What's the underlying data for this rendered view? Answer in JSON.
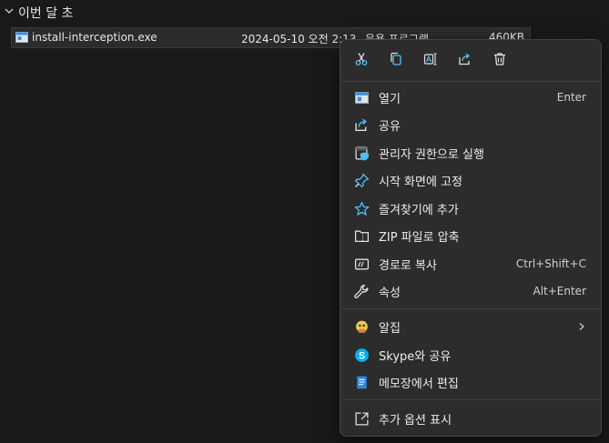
{
  "group": {
    "title": "이번 달 초"
  },
  "file": {
    "name": "install-interception.exe",
    "date": "2024-05-10 오전 2:13",
    "type": "응용 프로그램",
    "size": "460KB"
  },
  "quick_actions": [
    {
      "icon": "cut-icon"
    },
    {
      "icon": "copy-icon"
    },
    {
      "icon": "rename-icon"
    },
    {
      "icon": "share-icon"
    },
    {
      "icon": "delete-icon"
    }
  ],
  "menu": {
    "open": {
      "label": "열기",
      "shortcut": "Enter",
      "icon": "open-window-icon"
    },
    "share": {
      "label": "공유",
      "icon": "share-icon"
    },
    "run_as_admin": {
      "label": "관리자 권한으로 실행",
      "icon": "shield-icon"
    },
    "pin_start": {
      "label": "시작 화면에 고정",
      "icon": "pin-icon"
    },
    "add_favorites": {
      "label": "즐겨찾기에 추가",
      "icon": "star-icon"
    },
    "zip": {
      "label": "ZIP 파일로 압축",
      "icon": "zip-folder-icon"
    },
    "copy_path": {
      "label": "경로로 복사",
      "shortcut": "Ctrl+Shift+C",
      "icon": "path-icon"
    },
    "properties": {
      "label": "속성",
      "shortcut": "Alt+Enter",
      "icon": "wrench-icon"
    },
    "alzip": {
      "label": "알집",
      "icon": "alzip-icon"
    },
    "skype": {
      "label": "Skype와 공유",
      "icon": "skype-icon"
    },
    "notepad": {
      "label": "메모장에서 편집",
      "icon": "notepad-icon"
    },
    "more_options": {
      "label": "추가 옵션 표시",
      "icon": "expand-icon"
    }
  },
  "colors": {
    "accent": "#4cc2ff",
    "menu_bg": "#2c2c2c",
    "page_bg": "#191919"
  }
}
